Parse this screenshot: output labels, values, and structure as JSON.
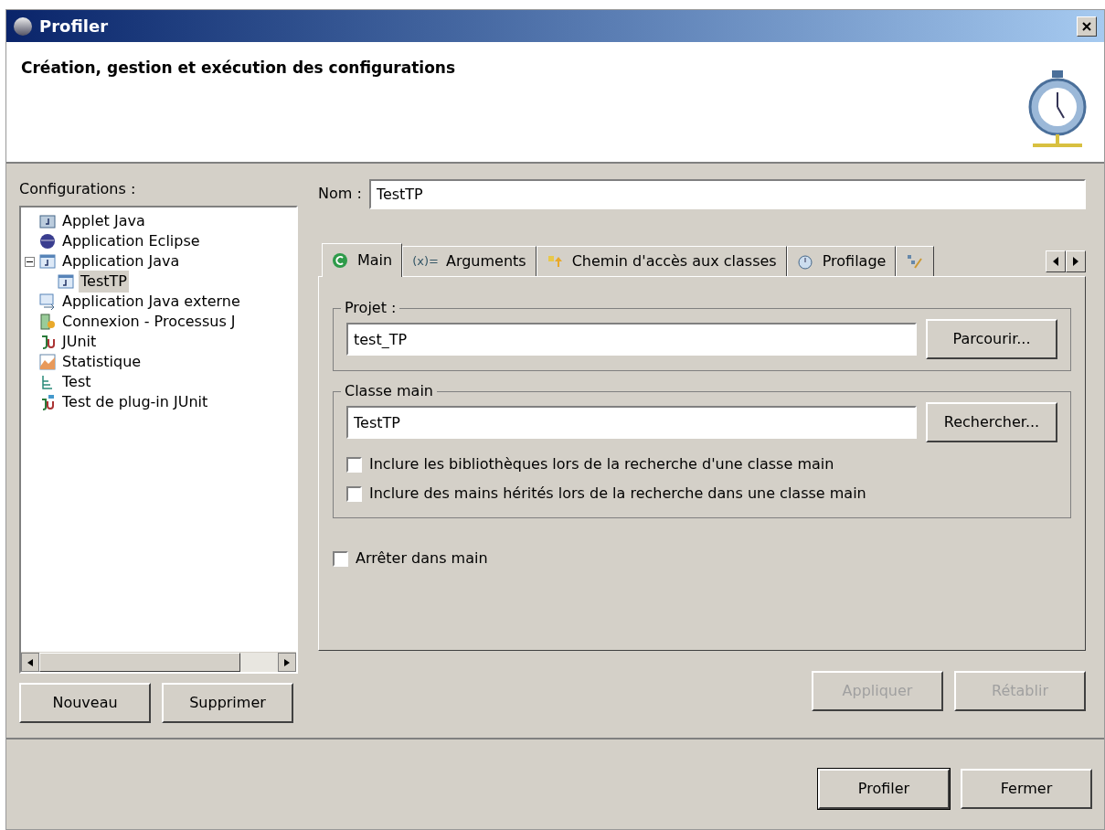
{
  "window": {
    "title": "Profiler"
  },
  "header": {
    "title": "Création, gestion et exécution des configurations"
  },
  "configurations": {
    "label": "Configurations :",
    "items": [
      {
        "label": "Applet Java",
        "kind": "applet",
        "selected": false
      },
      {
        "label": "Application Eclipse",
        "kind": "eclipse",
        "selected": false
      },
      {
        "label": "Application Java",
        "kind": "java",
        "selected": false,
        "expanded": true,
        "children": [
          {
            "label": "TestTP",
            "kind": "java",
            "selected": true
          }
        ]
      },
      {
        "label": "Application Java externe",
        "kind": "external",
        "selected": false
      },
      {
        "label": "Connexion - Processus J",
        "kind": "connect",
        "selected": false
      },
      {
        "label": "JUnit",
        "kind": "junit",
        "selected": false
      },
      {
        "label": "Statistique",
        "kind": "stats",
        "selected": false
      },
      {
        "label": "Test",
        "kind": "test",
        "selected": false
      },
      {
        "label": "Test de plug-in JUnit",
        "kind": "plugin",
        "selected": false
      }
    ]
  },
  "left_buttons": [
    "Nouveau",
    "Supprimer"
  ],
  "name_field": {
    "label": "Nom :",
    "value": "TestTP"
  },
  "tabs": [
    {
      "label": "Main",
      "kind": "main",
      "selected": true
    },
    {
      "label": "Arguments",
      "icon_text": "(x)=",
      "selected": false
    },
    {
      "label": "Chemin d'accès aux classes",
      "kind": "classpath",
      "selected": false
    },
    {
      "label": "Profilage",
      "kind": "profile",
      "selected": false
    },
    {
      "kind": "more",
      "selected": false
    }
  ],
  "project": {
    "label": "Projet :",
    "value": "test_TP",
    "button": "Parcourir..."
  },
  "main_class": {
    "label": "Classe main",
    "value": "TestTP",
    "button": "Rechercher...",
    "options": [
      {
        "label": "Inclure les bibliothèques lors de la recherche d'une classe main",
        "checked": false
      },
      {
        "label": "Inclure des mains hérités lors de la recherche dans une classe main",
        "checked": false
      }
    ]
  },
  "stop_in_main": {
    "label": "Arrêter dans main",
    "checked": false
  },
  "apply_buttons": [
    {
      "label": "Appliquer",
      "disabled": true
    },
    {
      "label": "Rétablir",
      "disabled": true
    }
  ],
  "dialog_buttons": [
    {
      "label": "Profiler",
      "default": true
    },
    {
      "label": "Fermer",
      "default": false
    }
  ]
}
